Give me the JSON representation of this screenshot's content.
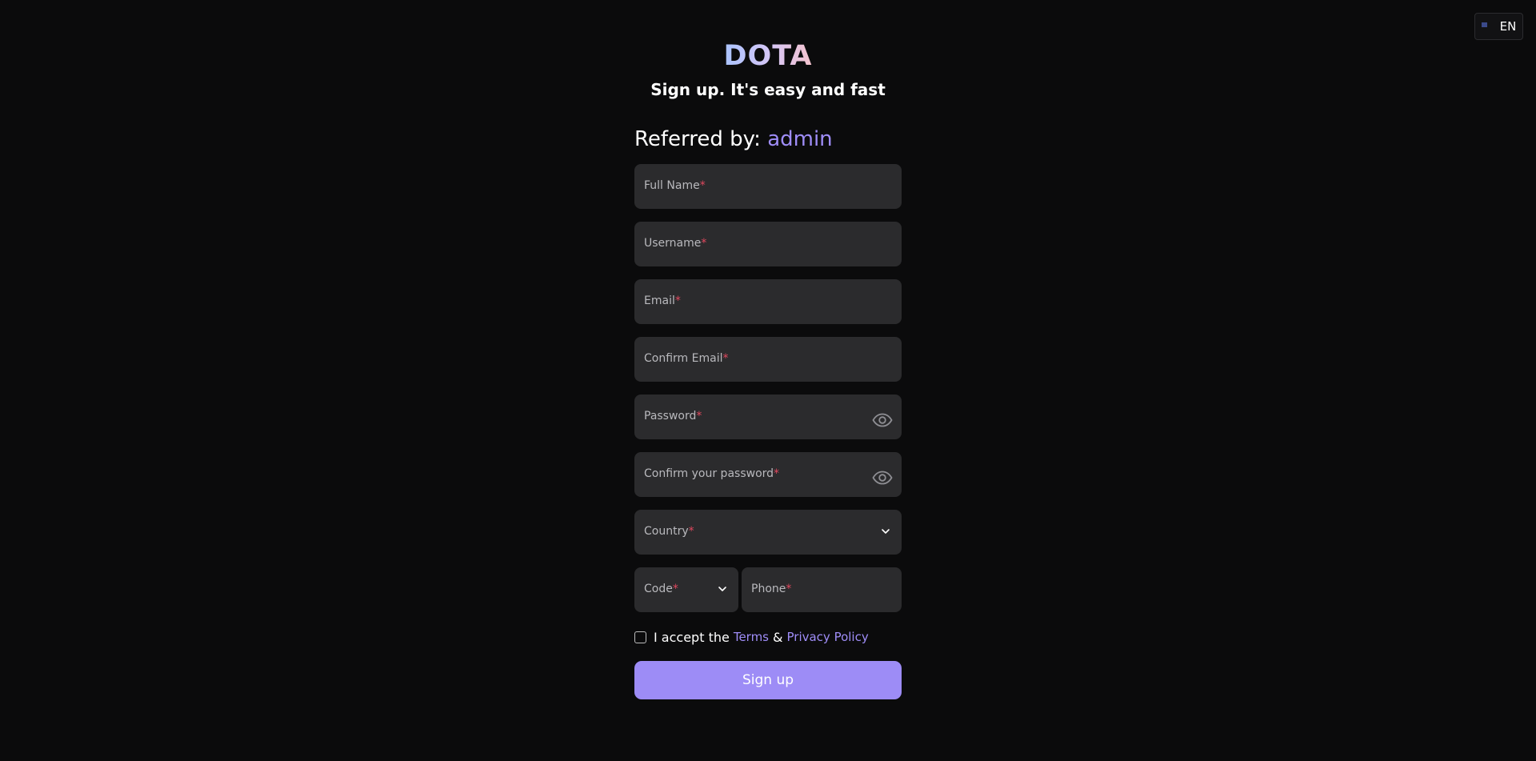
{
  "language": {
    "code": "EN",
    "flag_icon": "us-flag-icon"
  },
  "brand": {
    "name": "DOTA"
  },
  "tagline": "Sign up. It's easy and fast",
  "referral": {
    "prefix": "Referred by:",
    "name": "admin"
  },
  "form": {
    "required_mark": "*",
    "full_name": {
      "label": "Full Name"
    },
    "username": {
      "label": "Username"
    },
    "email": {
      "label": "Email"
    },
    "confirm_email": {
      "label": "Confirm Email"
    },
    "password": {
      "label": "Password",
      "toggle_icon": "eye-icon"
    },
    "confirm_password": {
      "label": "Confirm your password",
      "toggle_icon": "eye-icon"
    },
    "country": {
      "label": "Country",
      "icon": "chevron-down-icon"
    },
    "code": {
      "label": "Code",
      "icon": "chevron-down-icon"
    },
    "phone": {
      "label": "Phone"
    }
  },
  "terms": {
    "prefix": "I accept the",
    "terms_link": "Terms",
    "ampersand": "&",
    "privacy_link": "Privacy Policy",
    "checked": false
  },
  "submit_label": "Sign up",
  "colors": {
    "background": "#0b0b0c",
    "field": "#2b2b2d",
    "accent": "#9d8cf6",
    "required": "#e0485e"
  }
}
